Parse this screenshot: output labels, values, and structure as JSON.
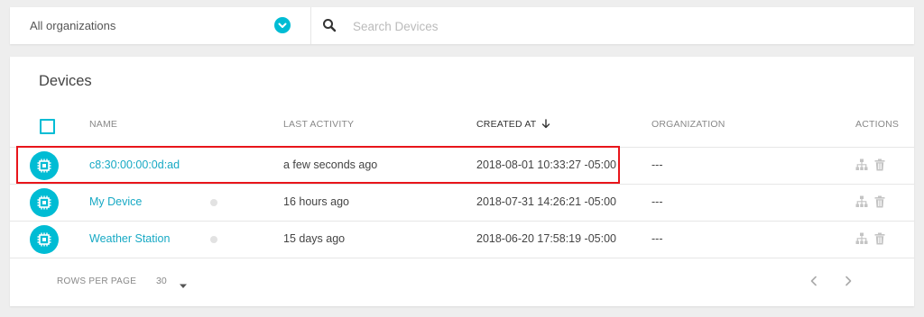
{
  "topbar": {
    "organization_select": "All organizations",
    "search_placeholder": "Search Devices"
  },
  "devices": {
    "title": "Devices",
    "columns": {
      "name": "NAME",
      "last_activity": "LAST ACTIVITY",
      "created_at": "CREATED AT",
      "organization": "ORGANIZATION",
      "actions": "ACTIONS"
    },
    "sort": {
      "column": "created_at",
      "direction": "descending",
      "icon": "arrow-down-icon"
    },
    "rows": [
      {
        "name": "c8:30:00:00:0d:ad",
        "last_activity": "a few seconds ago",
        "created_at": "2018-08-01 10:33:27 -05:00",
        "organization": "---",
        "highlighted": true,
        "status_dot": false
      },
      {
        "name": "My Device",
        "last_activity": "16 hours ago",
        "created_at": "2018-07-31 14:26:21 -05:00",
        "organization": "---",
        "highlighted": false,
        "status_dot": true
      },
      {
        "name": "Weather Station",
        "last_activity": "15 days ago",
        "created_at": "2018-06-20 17:58:19 -05:00",
        "organization": "---",
        "highlighted": false,
        "status_dot": true
      }
    ],
    "footer": {
      "rows_per_page_label": "ROWS PER PAGE",
      "rows_per_page": "30"
    }
  },
  "colors": {
    "accent": "#00bcd4",
    "link": "#17a9c4",
    "highlight_border": "#e8151b",
    "background": "#eeeeee"
  },
  "icons": [
    "chevron-down-icon",
    "search-icon",
    "chip-icon",
    "arrow-down-icon",
    "sitemap-icon",
    "trash-icon",
    "caret-down-icon",
    "chevron-left-icon",
    "chevron-right-icon"
  ]
}
